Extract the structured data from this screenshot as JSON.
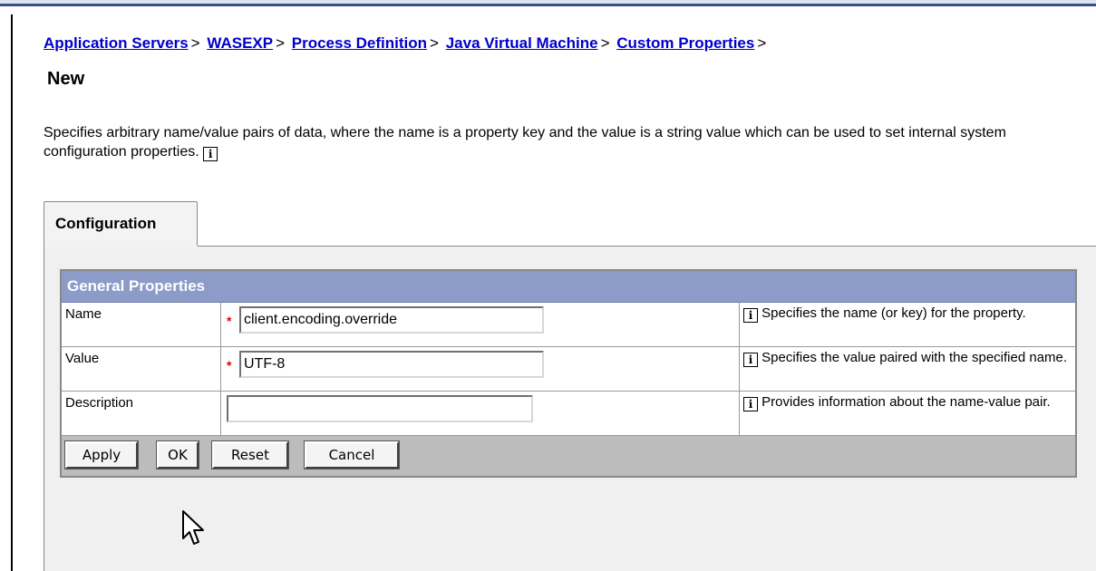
{
  "breadcrumb": {
    "items": [
      {
        "label": "Application Servers"
      },
      {
        "label": "WASEXP"
      },
      {
        "label": "Process Definition"
      },
      {
        "label": "Java Virtual Machine"
      },
      {
        "label": "Custom Properties"
      }
    ],
    "separator": ">"
  },
  "page": {
    "title": "New",
    "description": "Specifies arbitrary name/value pairs of data, where the name is a property key and the value is a string value which can be used to set internal system configuration properties."
  },
  "tab": {
    "label": "Configuration"
  },
  "general_properties": {
    "header": "General Properties",
    "name": {
      "label": "Name",
      "value": "client.encoding.override",
      "help": "Specifies the name (or key) for the property.",
      "required": true
    },
    "value": {
      "label": "Value",
      "value": "UTF-8",
      "help": "Specifies the value paired with the specified name.",
      "required": true
    },
    "description": {
      "label": "Description",
      "value": "",
      "help": "Provides information about the name-value pair.",
      "required": false
    }
  },
  "buttons": {
    "apply": "Apply",
    "ok": "OK",
    "reset": "Reset",
    "cancel": "Cancel"
  },
  "icons": {
    "info": "i",
    "required": "*"
  }
}
